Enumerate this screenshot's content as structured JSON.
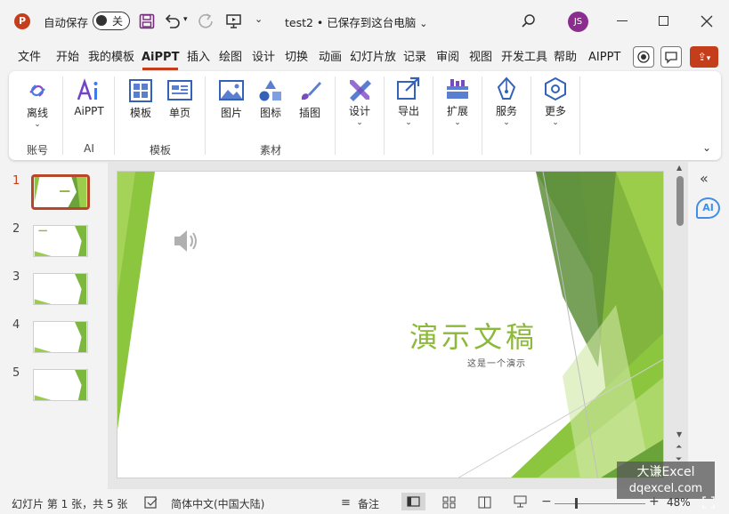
{
  "titlebar": {
    "autosave_label": "自动保存",
    "autosave_state": "关",
    "doc_title": "test2 • 已保存到这台电脑",
    "user_initials": "JS"
  },
  "tabs": [
    "文件",
    "开始",
    "我的模板",
    "AiPPT",
    "插入",
    "绘图",
    "设计",
    "切换",
    "动画",
    "幻灯片放映",
    "记录",
    "审阅",
    "视图",
    "开发工具",
    "帮助",
    "AIPPT"
  ],
  "active_tab": "AiPPT",
  "ribbon": {
    "buttons": {
      "offline": "离线",
      "aippt": "AiPPT",
      "template": "模板",
      "single_page": "单页",
      "image": "图片",
      "icon": "图标",
      "illustration": "插图",
      "design": "设计",
      "export": "导出",
      "extend": "扩展",
      "service": "服务",
      "more": "更多"
    },
    "groups": {
      "account": "账号",
      "ai": "AI",
      "template": "模板",
      "material": "素材"
    }
  },
  "thumbnails": [
    "1",
    "2",
    "3",
    "4",
    "5"
  ],
  "selected_slide": "1",
  "slide": {
    "title": "演示文稿",
    "subtitle": "这是一个演示"
  },
  "status": {
    "slide_info": "幻灯片 第 1 张，共 5 张",
    "language": "简体中文(中国大陆)",
    "notes": "备注",
    "zoom": "48%"
  },
  "watermark": {
    "line1": "大谦Excel",
    "line2": "dqexcel.com"
  },
  "colors": {
    "accent": "#c43e1c",
    "green_light": "#8cc63f",
    "green_dark": "#4e8a2c",
    "title_green": "#8cb93c"
  }
}
